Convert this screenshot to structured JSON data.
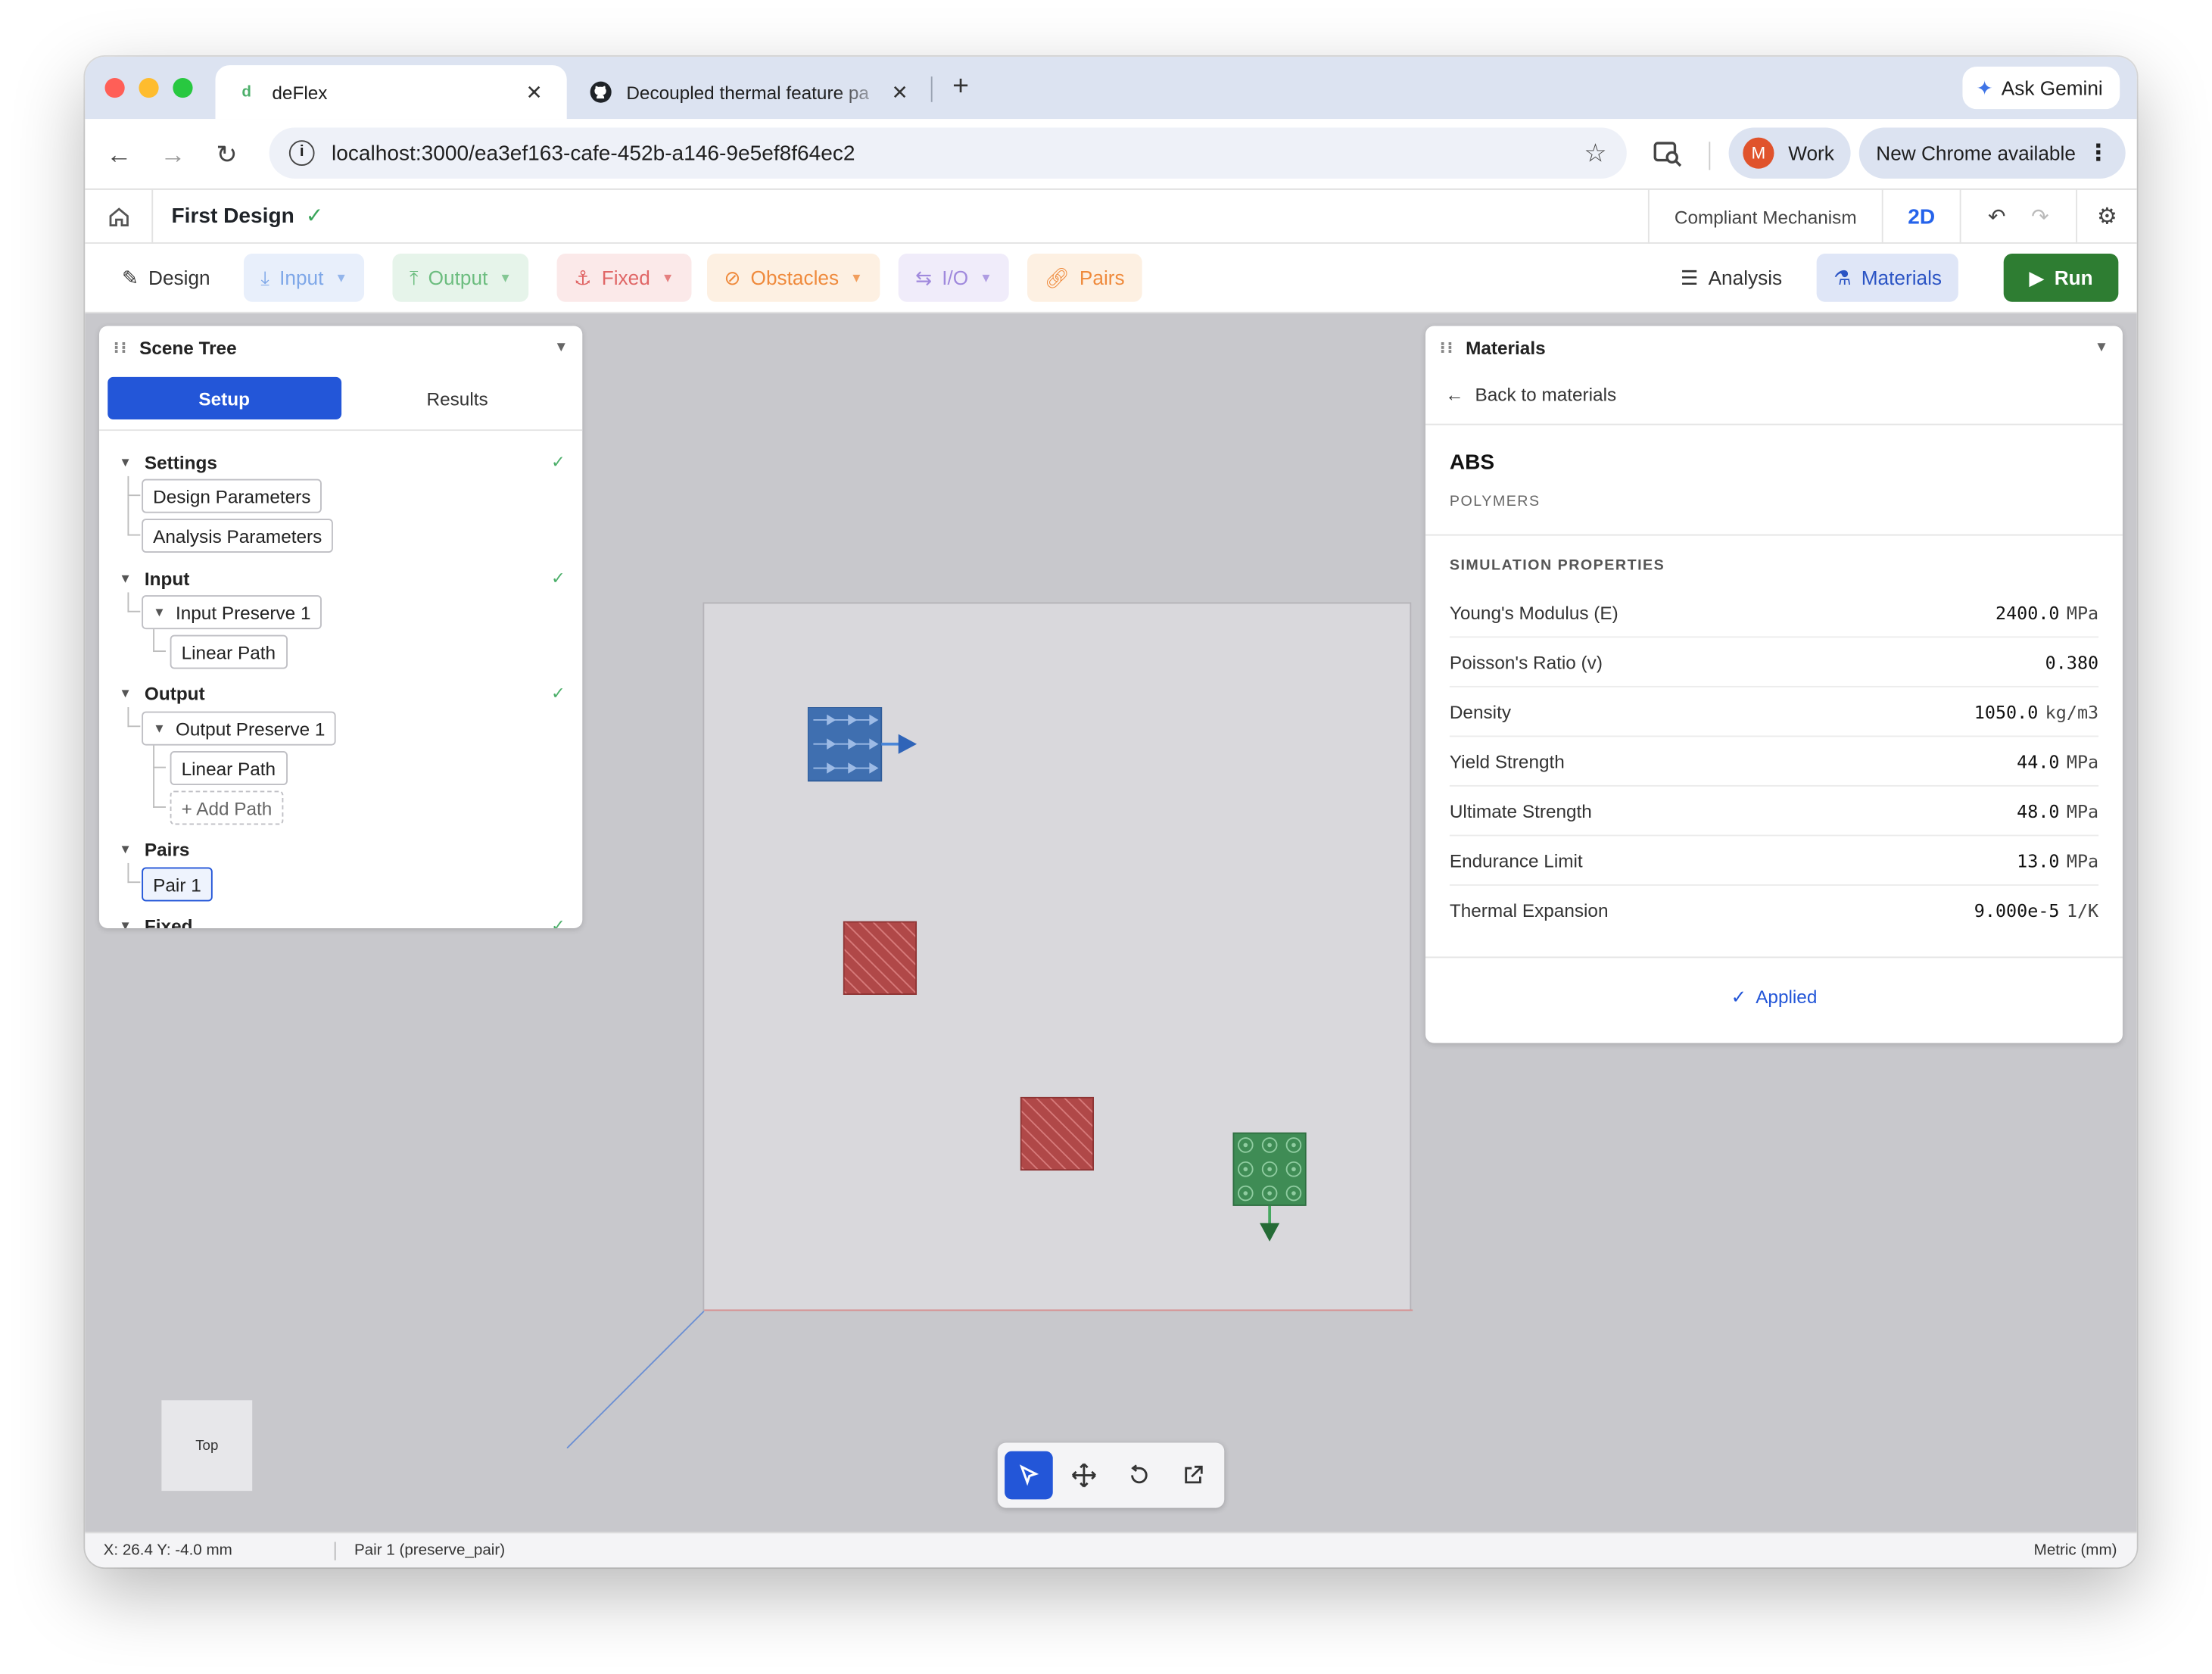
{
  "browser": {
    "tabs": [
      {
        "label": "deFlex",
        "favicon": "d"
      },
      {
        "label": "Decoupled thermal feature pa",
        "favicon": "github-icon"
      }
    ],
    "ask_gemini": "Ask Gemini",
    "url": "localhost:3000/ea3ef163-cafe-452b-a146-9e5ef8f64ec2",
    "profile_initial": "M",
    "profile_name": "Work",
    "update_label": "New Chrome available"
  },
  "header": {
    "design_title": "First Design",
    "mode_label": "Compliant Mechanism",
    "view_label": "2D"
  },
  "ribbon": {
    "design": "Design",
    "input": "Input",
    "output": "Output",
    "fixed": "Fixed",
    "obstacles": "Obstacles",
    "io": "I/O",
    "pairs": "Pairs",
    "analysis": "Analysis",
    "materials": "Materials",
    "run": "Run"
  },
  "scene_tree": {
    "title": "Scene Tree",
    "tabs": [
      "Setup",
      "Results"
    ],
    "sections": {
      "settings": "Settings",
      "input": "Input",
      "output": "Output",
      "pairs": "Pairs",
      "fixed": "Fixed"
    },
    "items": {
      "design_parameters": "Design Parameters",
      "analysis_parameters": "Analysis Parameters",
      "input_preserve": "Input Preserve 1",
      "input_linear_path": "Linear Path",
      "output_preserve": "Output Preserve 1",
      "output_linear_path": "Linear Path",
      "add_path": "+ Add Path",
      "pair": "Pair 1"
    }
  },
  "materials": {
    "title": "Materials",
    "back_label": "Back to materials",
    "name": "ABS",
    "category": "POLYMERS",
    "section_title": "SIMULATION PROPERTIES",
    "properties": [
      {
        "label": "Young's Modulus (E)",
        "value": "2400.0",
        "unit": "MPa"
      },
      {
        "label": "Poisson's Ratio (v)",
        "value": "0.380",
        "unit": ""
      },
      {
        "label": "Density",
        "value": "1050.0",
        "unit": "kg/m3"
      },
      {
        "label": "Yield Strength",
        "value": "44.0",
        "unit": "MPa"
      },
      {
        "label": "Ultimate Strength",
        "value": "48.0",
        "unit": "MPa"
      },
      {
        "label": "Endurance Limit",
        "value": "13.0",
        "unit": "MPa"
      },
      {
        "label": "Thermal Expansion",
        "value": "9.000e-5",
        "unit": "1/K"
      }
    ],
    "status": "Applied"
  },
  "viewport": {
    "view_cube_label": "Top"
  },
  "status_bar": {
    "coords": "X: 26.4 Y: -4.0 mm",
    "selection": "Pair 1 (preserve_pair)",
    "units": "Metric (mm)"
  },
  "colors": {
    "primary": "#2356d8",
    "run": "#2e7d32",
    "input_region": "#3f6fb0",
    "output_region": "#3f8c55",
    "obstacle_region": "#b04848"
  }
}
